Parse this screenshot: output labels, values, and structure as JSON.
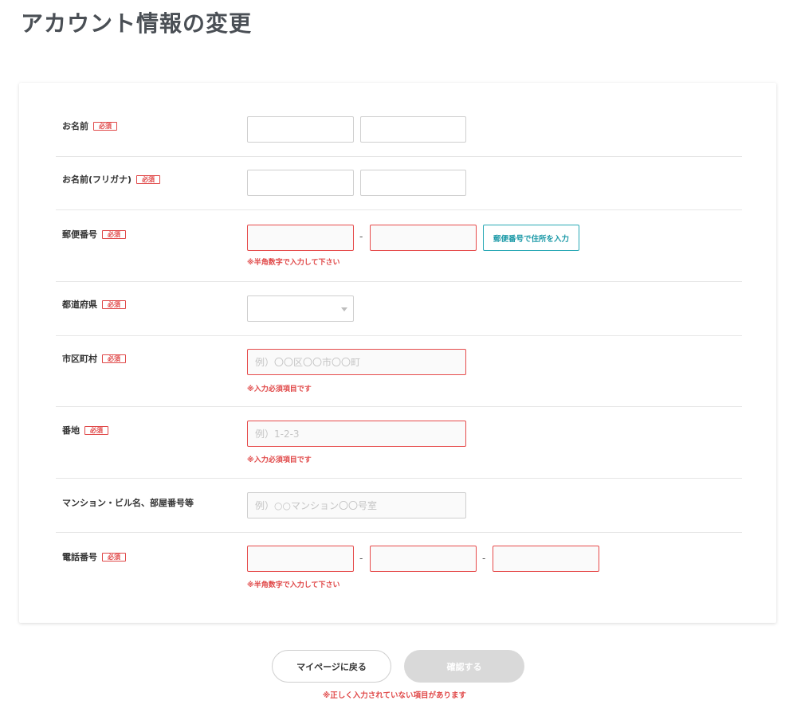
{
  "page_title": "アカウント情報の変更",
  "required_badge": "必須",
  "colors": {
    "error": "#e04848",
    "accent": "#1d9aa8",
    "disabled": "#d9d9d9"
  },
  "form": {
    "name": {
      "label": "お名前",
      "required": true,
      "last_value": "",
      "first_value": ""
    },
    "name_kana": {
      "label": "お名前(フリガナ)",
      "required": true,
      "last_value": "",
      "first_value": ""
    },
    "postal": {
      "label": "郵便番号",
      "required": true,
      "separator": "-",
      "part1": "",
      "part2": "",
      "lookup_button": "郵便番号で住所を入力",
      "error": "※半角数字で入力して下さい"
    },
    "prefecture": {
      "label": "都道府県",
      "required": true,
      "selected": ""
    },
    "city": {
      "label": "市区町村",
      "required": true,
      "placeholder": "例）〇〇区〇〇市〇〇町",
      "error": "※入力必須項目です"
    },
    "street": {
      "label": "番地",
      "required": true,
      "placeholder": "例）1-2-3",
      "error": "※入力必須項目です"
    },
    "building": {
      "label": "マンション・ビル名、部屋番号等",
      "required": false,
      "placeholder": "例）○○マンション〇〇号室"
    },
    "phone": {
      "label": "電話番号",
      "required": true,
      "separator": "-",
      "part1": "",
      "part2": "",
      "part3": "",
      "error": "※半角数字で入力して下さい"
    }
  },
  "buttons": {
    "back": "マイページに戻る",
    "confirm": "確認する"
  },
  "form_error": "※正しく入力されていない項目があります"
}
